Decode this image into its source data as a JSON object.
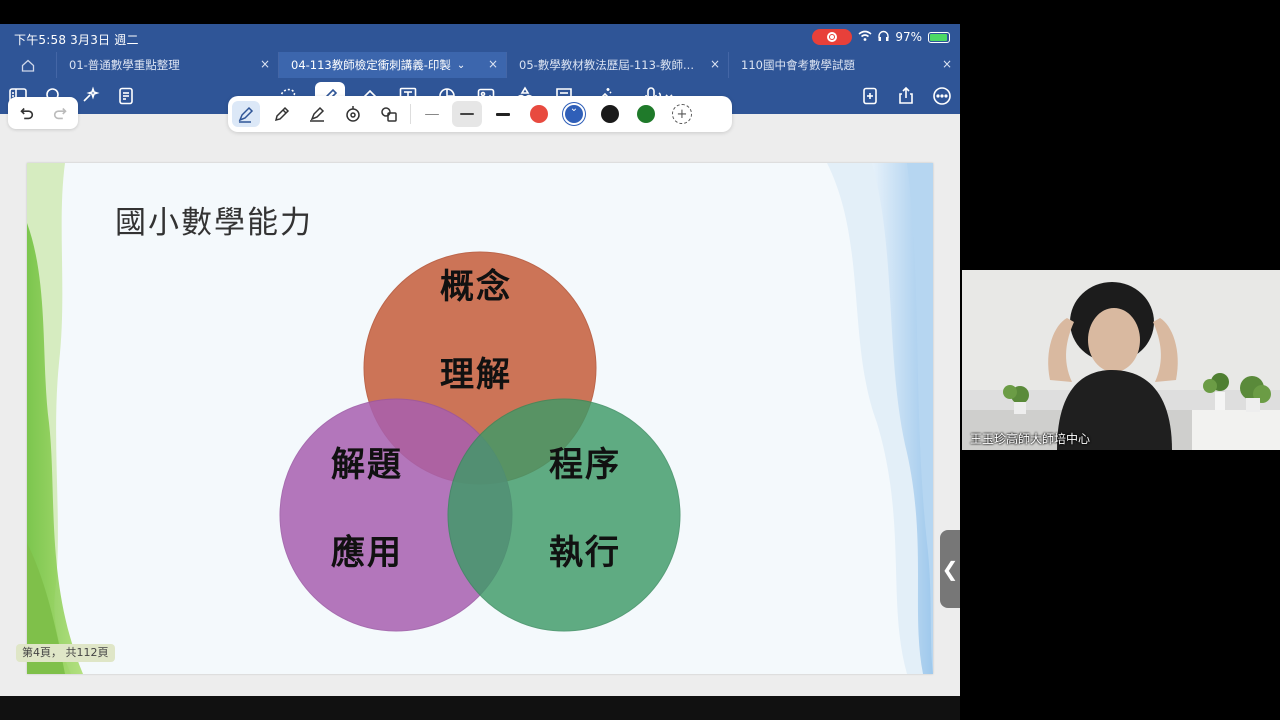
{
  "status": {
    "time_date": "下午5:58   3月3日 週二",
    "battery": "97%"
  },
  "tabs": [
    {
      "label": "01-普通數學重點整理",
      "active": false
    },
    {
      "label": "04-113教師檢定衝刺講義-印製",
      "active": true
    },
    {
      "label": "05-數學教材教法歷屆-113-教師...",
      "active": false
    },
    {
      "label": "110國中會考數學試題",
      "active": false
    }
  ],
  "toolbar_icons": [
    "sidebar-icon",
    "search-icon",
    "ai-sparkle-icon",
    "document-icon",
    "lasso-icon",
    "pen-icon",
    "eraser-icon",
    "text-box-icon",
    "shape-icon",
    "image-icon",
    "elements-icon",
    "sticky-note-icon",
    "laser-pointer-icon",
    "microphone-icon",
    "add-page-icon",
    "share-icon",
    "more-icon"
  ],
  "pen_colors": [
    "#1a1a1a",
    "#3a3a3a",
    "#e84a3f",
    "#2f5fb8",
    "#1a1a1a",
    "#1f7a2a"
  ],
  "slide": {
    "title": "國小數學能力",
    "circles": [
      {
        "line1": "概念",
        "line2": "理解",
        "color": "#c9694a"
      },
      {
        "line1": "解題",
        "line2": "應用",
        "color": "#a860b0"
      },
      {
        "line1": "程序",
        "line2": "執行",
        "color": "#3f9a68"
      }
    ]
  },
  "page_indicator": "第4頁， 共112頁",
  "side_handle": "❮",
  "video": {
    "name": "王玉珍高師大師培中心"
  }
}
